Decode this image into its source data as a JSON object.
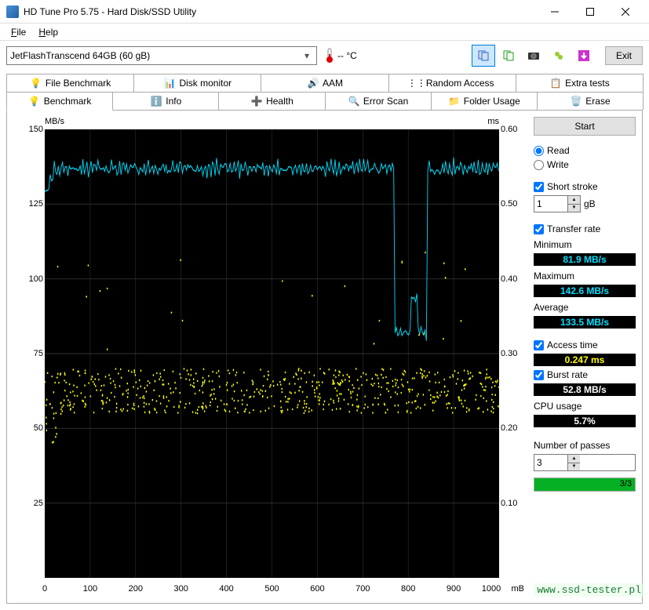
{
  "window": {
    "title": "HD Tune Pro 5.75 - Hard Disk/SSD Utility"
  },
  "menu": {
    "file": "File",
    "help": "Help"
  },
  "toolbar": {
    "device": "JetFlashTranscend 64GB (60 gB)",
    "temp": "-- °C",
    "exit": "Exit"
  },
  "tabs_row1": [
    {
      "label": "File Benchmark"
    },
    {
      "label": "Disk monitor"
    },
    {
      "label": "AAM"
    },
    {
      "label": "Random Access"
    },
    {
      "label": "Extra tests"
    }
  ],
  "tabs_row2": [
    {
      "label": "Benchmark"
    },
    {
      "label": "Info"
    },
    {
      "label": "Health"
    },
    {
      "label": "Error Scan"
    },
    {
      "label": "Folder Usage"
    },
    {
      "label": "Erase"
    }
  ],
  "panel": {
    "start": "Start",
    "read": "Read",
    "write": "Write",
    "short_stroke": "Short stroke",
    "short_stroke_val": "1",
    "short_stroke_unit": "gB",
    "transfer_rate": "Transfer rate",
    "minimum_label": "Minimum",
    "minimum_val": "81.9 MB/s",
    "maximum_label": "Maximum",
    "maximum_val": "142.6 MB/s",
    "average_label": "Average",
    "average_val": "133.5 MB/s",
    "access_time": "Access time",
    "access_time_val": "0.247 ms",
    "burst_rate": "Burst rate",
    "burst_rate_val": "52.8 MB/s",
    "cpu_usage": "CPU usage",
    "cpu_usage_val": "5.7%",
    "passes_label": "Number of passes",
    "passes_val": "3",
    "progress_text": "3/3"
  },
  "chart_data": {
    "type": "line+scatter",
    "xlabel": "mB",
    "ylabel_left": "MB/s",
    "ylabel_right": "ms",
    "x_range": [
      0,
      1000
    ],
    "y_left_range": [
      0,
      150
    ],
    "y_right_range": [
      0,
      0.6
    ],
    "x_ticks": [
      0,
      100,
      200,
      300,
      400,
      500,
      600,
      700,
      800,
      900,
      1000
    ],
    "y_left_ticks": [
      25,
      50,
      75,
      100,
      125,
      150
    ],
    "y_right_ticks": [
      0.1,
      0.2,
      0.3,
      0.4,
      0.5,
      0.6
    ],
    "transfer_line": {
      "note": "cyan line ~137 MB/s with dip to ~82 MB/s between x≈770-840",
      "baseline": 137,
      "dip_start_x": 770,
      "dip_end_x": 840,
      "dip_min": 82
    },
    "access_scatter": {
      "note": "yellow dots, main band ~0.24-0.27 ms with sparse outliers 0.30-0.45",
      "band_center_ms": 0.25,
      "band_spread_ms": 0.03
    }
  },
  "watermark": "www.ssd-tester.pl"
}
